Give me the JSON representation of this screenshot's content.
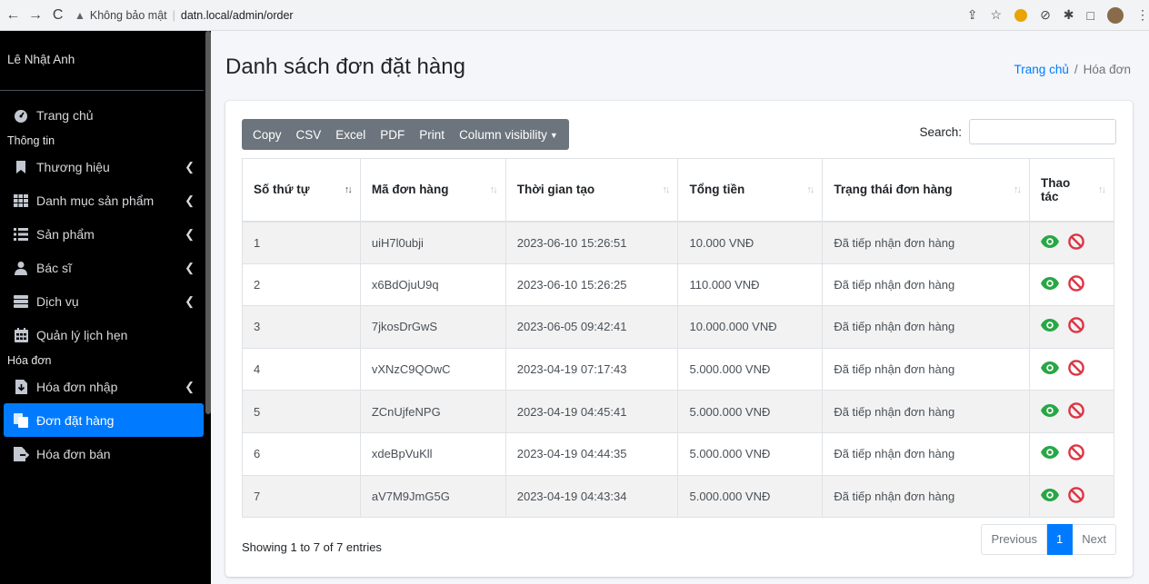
{
  "browser": {
    "security_label": "Không bảo mật",
    "url": "datn.local/admin/order"
  },
  "sidebar": {
    "user_name": "Lê Nhật Anh",
    "items": [
      {
        "type": "item",
        "label": "Trang chủ",
        "icon": "dashboard-icon",
        "has_chevron": false
      },
      {
        "type": "section",
        "label": "Thông tin"
      },
      {
        "type": "item",
        "label": "Thương hiệu",
        "icon": "bookmark-icon",
        "has_chevron": true
      },
      {
        "type": "item",
        "label": "Danh mục sản phẩm",
        "icon": "grid-icon",
        "has_chevron": true
      },
      {
        "type": "item",
        "label": "Sản phẩm",
        "icon": "list-icon",
        "has_chevron": true
      },
      {
        "type": "item",
        "label": "Bác sĩ",
        "icon": "doctor-icon",
        "has_chevron": true
      },
      {
        "type": "item",
        "label": "Dịch vụ",
        "icon": "server-icon",
        "has_chevron": true
      },
      {
        "type": "item",
        "label": "Quản lý lịch hẹn",
        "icon": "calendar-icon",
        "has_chevron": false
      },
      {
        "type": "section",
        "label": "Hóa đơn"
      },
      {
        "type": "item",
        "label": "Hóa đơn nhập",
        "icon": "file-download-icon",
        "has_chevron": true
      },
      {
        "type": "item",
        "label": "Đơn đặt hàng",
        "icon": "copy-icon",
        "has_chevron": false,
        "active": true
      },
      {
        "type": "item",
        "label": "Hóa đơn bán",
        "icon": "file-export-icon",
        "has_chevron": false
      }
    ]
  },
  "page": {
    "title": "Danh sách đơn đặt hàng",
    "breadcrumb_home": "Trang chủ",
    "breadcrumb_sep": "/",
    "breadcrumb_current": "Hóa đơn"
  },
  "toolbar": {
    "copy": "Copy",
    "csv": "CSV",
    "excel": "Excel",
    "pdf": "PDF",
    "print": "Print",
    "colvis": "Column visibility",
    "search_label": "Search:"
  },
  "table": {
    "headers": [
      "Số thứ tự",
      "Mã đơn hàng",
      "Thời gian tạo",
      "Tổng tiền",
      "Trạng thái đơn hàng",
      "Thao tác"
    ],
    "rows": [
      [
        "1",
        "uiH7l0ubji",
        "2023-06-10 15:26:51",
        "10.000 VNĐ",
        "Đã tiếp nhận đơn hàng"
      ],
      [
        "2",
        "x6BdOjuU9q",
        "2023-06-10 15:26:25",
        "110.000 VNĐ",
        "Đã tiếp nhận đơn hàng"
      ],
      [
        "3",
        "7jkosDrGwS",
        "2023-06-05 09:42:41",
        "10.000.000 VNĐ",
        "Đã tiếp nhận đơn hàng"
      ],
      [
        "4",
        "vXNzC9QOwC",
        "2023-04-19 07:17:43",
        "5.000.000 VNĐ",
        "Đã tiếp nhận đơn hàng"
      ],
      [
        "5",
        "ZCnUjfeNPG",
        "2023-04-19 04:45:41",
        "5.000.000 VNĐ",
        "Đã tiếp nhận đơn hàng"
      ],
      [
        "6",
        "xdeBpVuKll",
        "2023-04-19 04:44:35",
        "5.000.000 VNĐ",
        "Đã tiếp nhận đơn hàng"
      ],
      [
        "7",
        "aV7M9JmG5G",
        "2023-04-19 04:43:34",
        "5.000.000 VNĐ",
        "Đã tiếp nhận đơn hàng"
      ]
    ]
  },
  "footer": {
    "info": "Showing 1 to 7 of 7 entries",
    "previous": "Previous",
    "current_page": "1",
    "next": "Next"
  },
  "colors": {
    "accent": "#007bff",
    "view": "#28a745",
    "delete": "#dc3545",
    "sidebar_bg": "#000000",
    "button_group": "#6c757d"
  }
}
